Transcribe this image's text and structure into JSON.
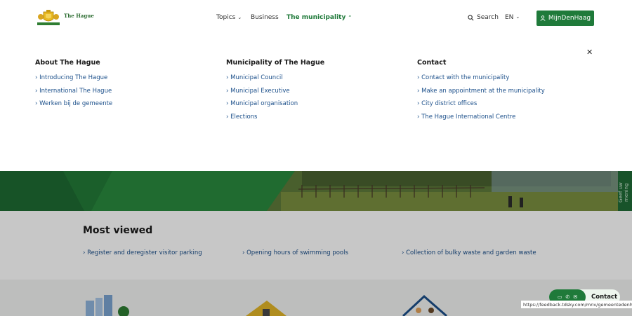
{
  "header": {
    "logo_text": "The Hague",
    "nav": [
      {
        "label": "Topics",
        "active": false
      },
      {
        "label": "Business",
        "active": false
      },
      {
        "label": "The municipality",
        "active": true
      }
    ],
    "search_label": "Search",
    "lang_label": "EN",
    "account_button": "MijnDenHaag",
    "icons": {
      "search": "search-icon",
      "user": "user-icon",
      "chevron": "chevron-icon"
    }
  },
  "megamenu": {
    "columns": [
      {
        "heading": "About The Hague",
        "links": [
          "Introducing The Hague",
          "International The Hague",
          "Werken bij de gemeente"
        ]
      },
      {
        "heading": "Municipality of The Hague",
        "links": [
          "Municipal Council",
          "Municipal Executive",
          "Municipal organisation",
          "Elections"
        ]
      },
      {
        "heading": "Contact",
        "links": [
          "Contact with the municipality",
          "Make an appointment at the municipality",
          "City district offices",
          "The Hague International Centre"
        ]
      }
    ]
  },
  "feedback_tab": "Geef uw mening",
  "most_viewed": {
    "title": "Most viewed",
    "links": [
      "Register and deregister visitor parking",
      "Opening hours of swimming pools",
      "Collection of bulky waste and garden waste"
    ]
  },
  "contact": {
    "label": "Contact"
  },
  "status_url": "https://feedback.tdsky.com/mnv/gemeentedenhaag",
  "colors": {
    "brand_green": "#1f7a3a",
    "link_blue": "#1b4f8a"
  }
}
